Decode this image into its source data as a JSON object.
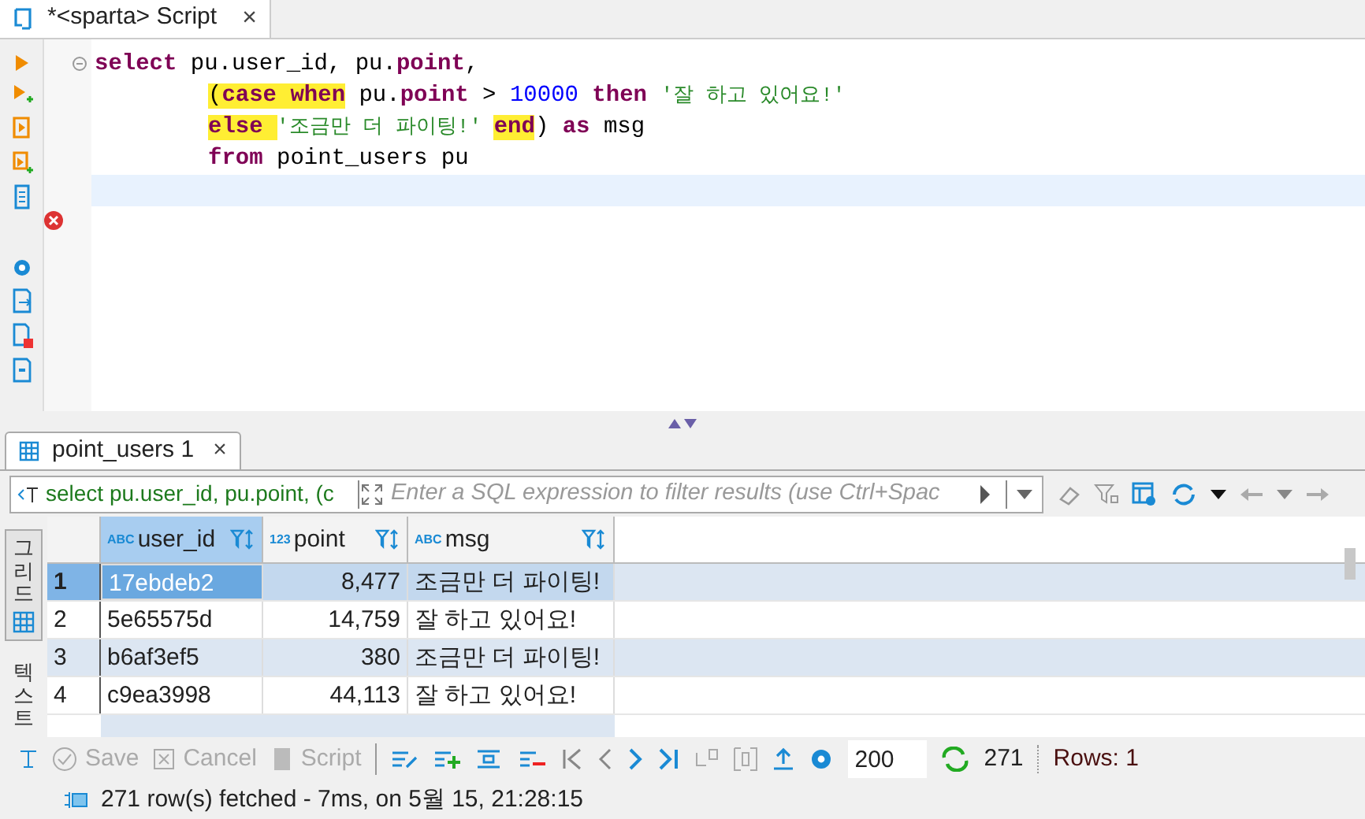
{
  "editor_tab": {
    "title": "*<sparta> Script",
    "close": "×"
  },
  "code_lines": [
    {
      "indented": false,
      "tokens": [
        {
          "text": "select",
          "kind": "keyword",
          "highlighted": false
        },
        {
          "text": " pu.user_id, pu.",
          "kind": "plain",
          "highlighted": false
        },
        {
          "text": "point",
          "kind": "keyword",
          "highlighted": false
        },
        {
          "text": ",",
          "kind": "plain",
          "highlighted": false
        }
      ]
    },
    {
      "indented": true,
      "tokens": [
        {
          "text": "(",
          "kind": "plain",
          "highlighted": true
        },
        {
          "text": "case when",
          "kind": "keyword",
          "highlighted": true
        },
        {
          "text": " pu.",
          "kind": "plain",
          "highlighted": false
        },
        {
          "text": "point",
          "kind": "keyword",
          "highlighted": false
        },
        {
          "text": " > ",
          "kind": "plain",
          "highlighted": false
        },
        {
          "text": "10000",
          "kind": "number",
          "highlighted": false
        },
        {
          "text": " then ",
          "kind": "keyword",
          "highlighted": false
        },
        {
          "text": "'잘 하고 있어요!'",
          "kind": "string",
          "highlighted": false
        }
      ]
    },
    {
      "indented": true,
      "tokens": [
        {
          "text": "else ",
          "kind": "keyword",
          "highlighted": true
        },
        {
          "text": "'조금만 더 파이팅!' ",
          "kind": "string",
          "highlighted": false
        },
        {
          "text": "end",
          "kind": "keyword",
          "highlighted": true
        },
        {
          "text": ") ",
          "kind": "plain",
          "highlighted": false
        },
        {
          "text": "as",
          "kind": "keyword",
          "highlighted": false
        },
        {
          "text": " msg",
          "kind": "plain",
          "highlighted": false
        }
      ]
    },
    {
      "indented": true,
      "tokens": [
        {
          "text": "from",
          "kind": "keyword",
          "highlighted": false
        },
        {
          "text": " point_users pu",
          "kind": "plain",
          "highlighted": false
        }
      ]
    }
  ],
  "results_tab": {
    "title": "point_users 1",
    "close": "×"
  },
  "filter": {
    "query": "select pu.user_id, pu.point, (c",
    "placeholder": "Enter a SQL expression to filter results (use Ctrl+Spac"
  },
  "side_tabs": [
    {
      "label": "그리드",
      "selected": true
    },
    {
      "label": "텍스트",
      "selected": false
    }
  ],
  "table": {
    "columns": [
      {
        "name": "user_id",
        "type": "ABC",
        "selected": true
      },
      {
        "name": "point",
        "type": "123",
        "selected": false
      },
      {
        "name": "msg",
        "type": "ABC",
        "selected": false
      }
    ],
    "rows": [
      {
        "num": "1",
        "selected": true,
        "cells": [
          "17ebdeb2",
          "8,477",
          "조금만 더 파이팅!"
        ]
      },
      {
        "num": "2",
        "selected": false,
        "cells": [
          "5e65575d",
          "14,759",
          "잘 하고 있어요!"
        ]
      },
      {
        "num": "3",
        "selected": false,
        "cells": [
          "b6af3ef5",
          "380",
          "조금만 더 파이팅!"
        ]
      },
      {
        "num": "4",
        "selected": false,
        "cells": [
          "c9ea3998",
          "44,113",
          "잘 하고 있어요!"
        ]
      }
    ]
  },
  "toolbar": {
    "save": "Save",
    "cancel": "Cancel",
    "script": "Script",
    "fetch_size": "200",
    "row_count": "271",
    "rows_label": "Rows: 1"
  },
  "status": "271 row(s) fetched - 7ms, on 5월 15, 21:28:15"
}
